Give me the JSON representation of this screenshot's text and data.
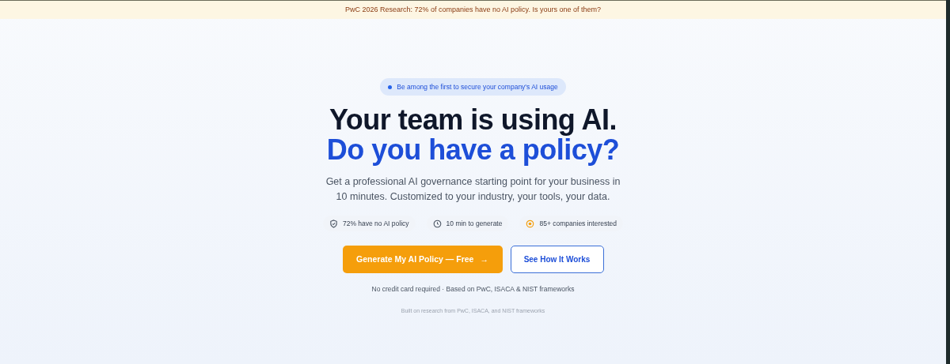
{
  "announcement": "PwC 2026 Research: 72% of companies have no AI policy. Is yours one of them?",
  "badge": "Be among the first to secure your company's AI usage",
  "headline": {
    "line_1": "Your team is using AI.",
    "line_2": "Do you have a policy?"
  },
  "subtitle": "Get a professional AI governance starting point for your business in 10 minutes. Customized to your industry, your tools, your data.",
  "stats": [
    {
      "kind": "shield",
      "label": "72% have no AI policy"
    },
    {
      "kind": "clock",
      "label": "10 min to generate"
    },
    {
      "kind": "spark",
      "label": "85+ companies interested"
    }
  ],
  "buttons": [
    {
      "kind": "primary",
      "label": "Generate My AI Policy — Free",
      "arrow": "→"
    },
    {
      "kind": "secondary",
      "label": "See How It Works"
    }
  ],
  "note": "No credit card required · Based on PwC, ISACA & NIST frameworks",
  "footer_note": "Built on research from PwC, ISACA, and NIST frameworks"
}
